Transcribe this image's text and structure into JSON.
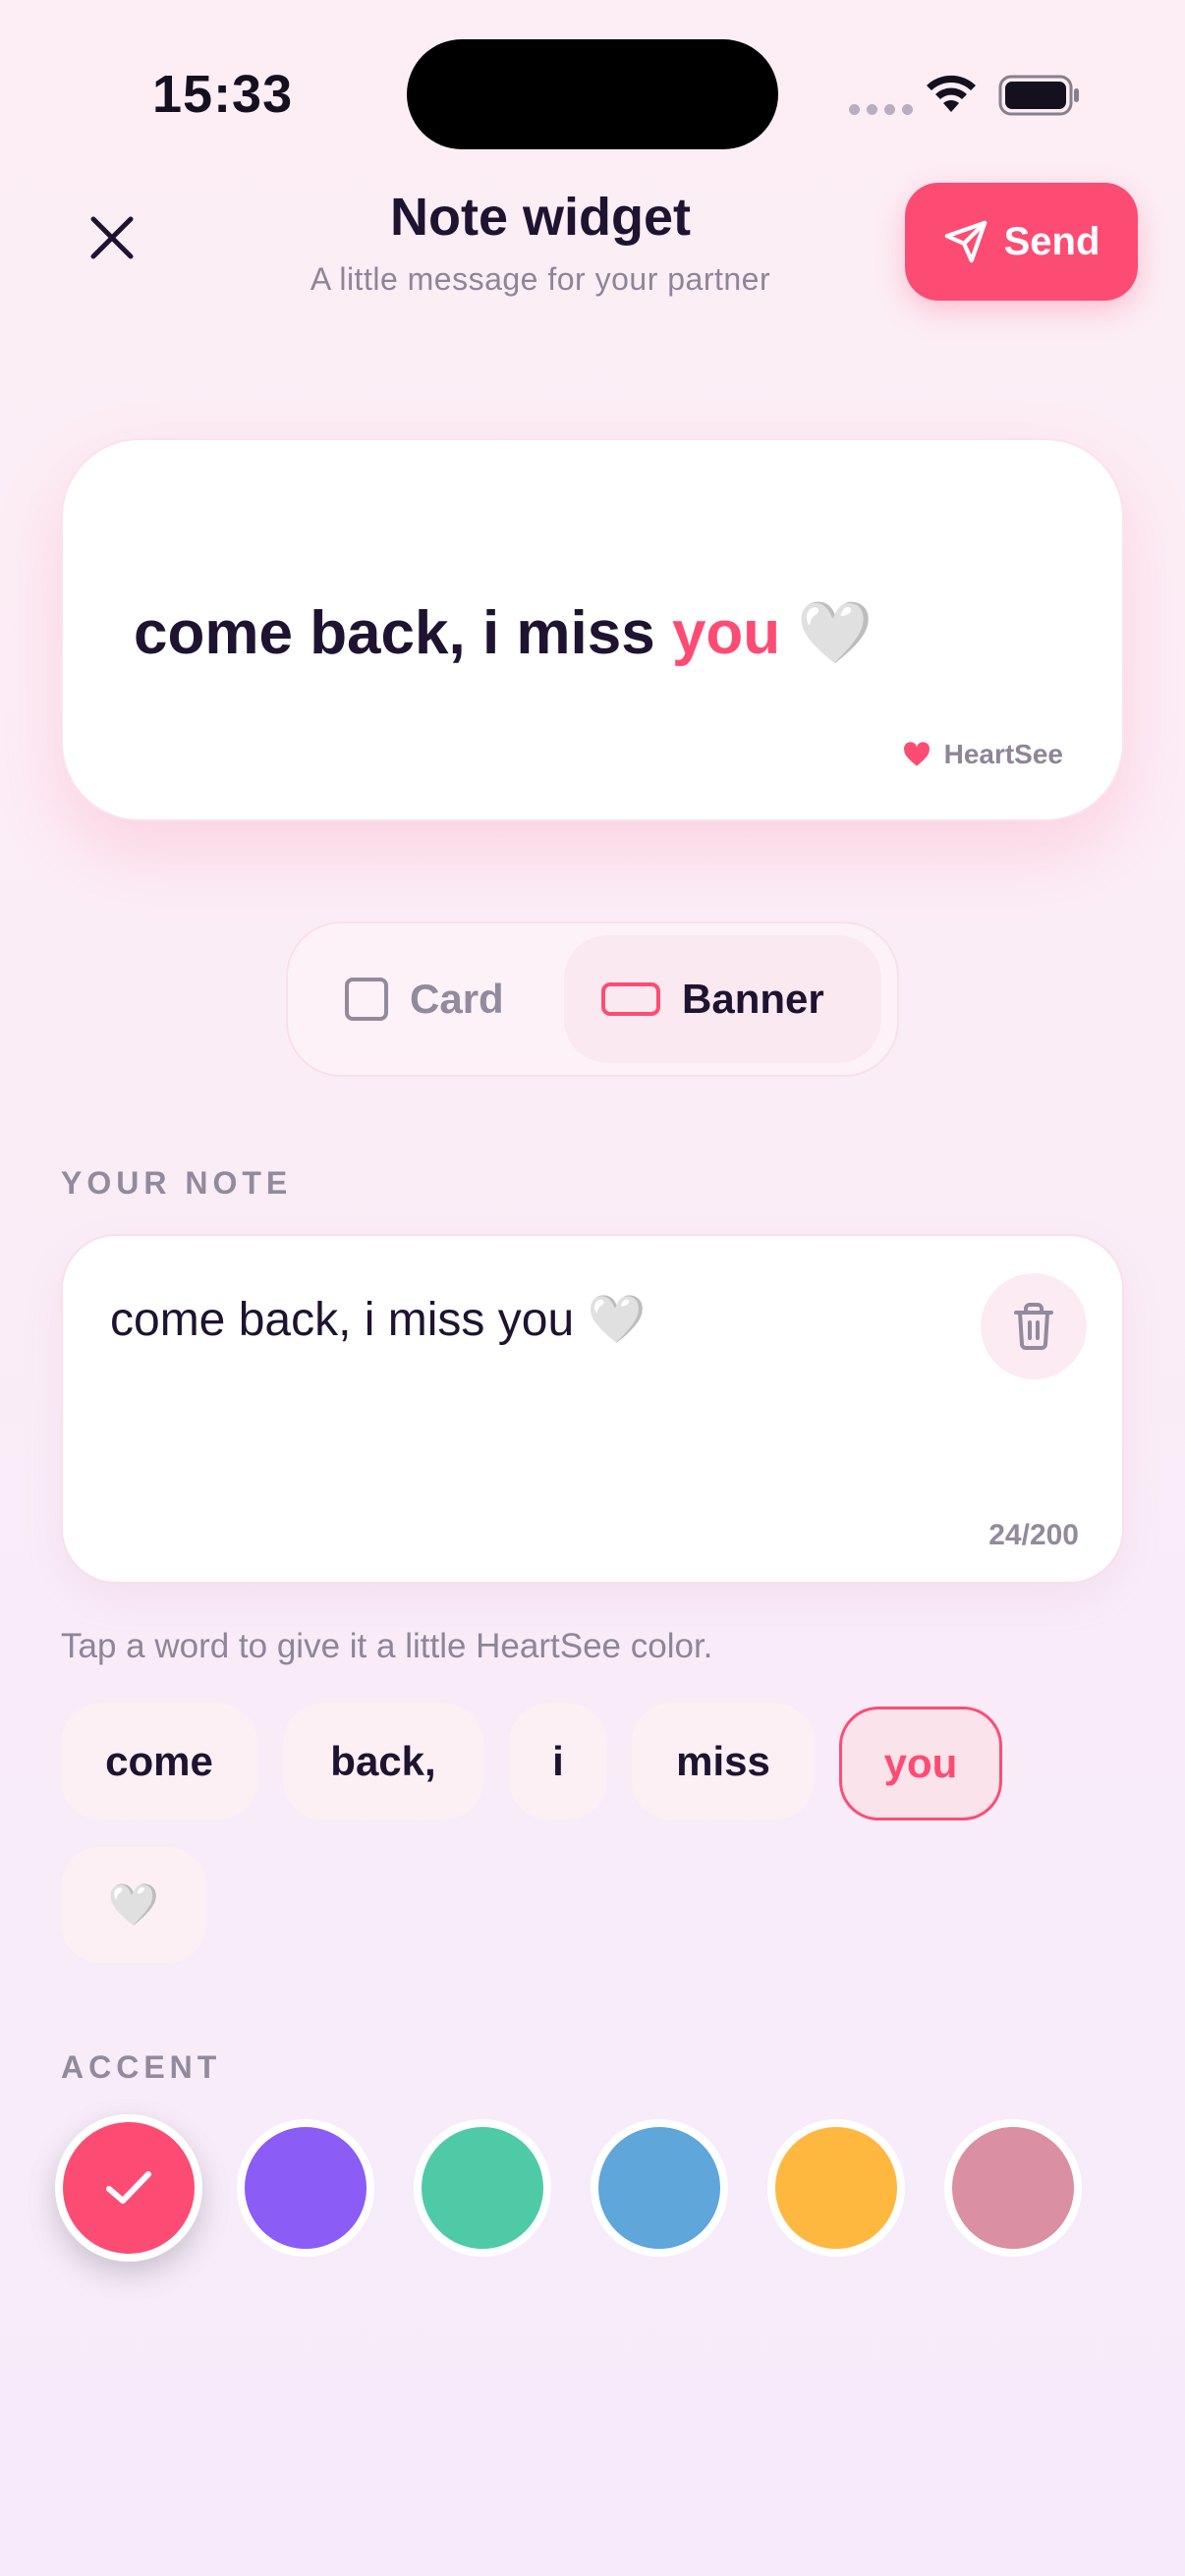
{
  "status_bar": {
    "time": "15:33"
  },
  "header": {
    "title": "Note widget",
    "subtitle": "A little message for your partner",
    "send_label": "Send"
  },
  "preview": {
    "text_before": "come back, i miss ",
    "accent_word": "you",
    "text_after": " 🤍",
    "brand": "HeartSee"
  },
  "layout_toggle": {
    "options": [
      {
        "label": "Card",
        "selected": false
      },
      {
        "label": "Banner",
        "selected": true
      }
    ]
  },
  "note_section": {
    "label": "YOUR NOTE",
    "value": "come back, i miss you 🤍",
    "char_count": "24/200"
  },
  "hint": "Tap a word to give it a little HeartSee color.",
  "word_chips": [
    {
      "label": "come",
      "selected": false
    },
    {
      "label": "back,",
      "selected": false
    },
    {
      "label": "i",
      "selected": false
    },
    {
      "label": "miss",
      "selected": false
    },
    {
      "label": "you",
      "selected": true
    },
    {
      "label": "🤍",
      "selected": false
    }
  ],
  "accent_section": {
    "label": "ACCENT",
    "colors": [
      {
        "hex": "#fd4c73",
        "selected": true
      },
      {
        "hex": "#8b5cf6",
        "selected": false
      },
      {
        "hex": "#4ecba6",
        "selected": false
      },
      {
        "hex": "#5fa6da",
        "selected": false
      },
      {
        "hex": "#ffb83f",
        "selected": false
      },
      {
        "hex": "#db8fa3",
        "selected": false
      }
    ]
  },
  "colors": {
    "primary": "#fd4c73",
    "text": "#1e1330",
    "muted": "#928a9d"
  }
}
